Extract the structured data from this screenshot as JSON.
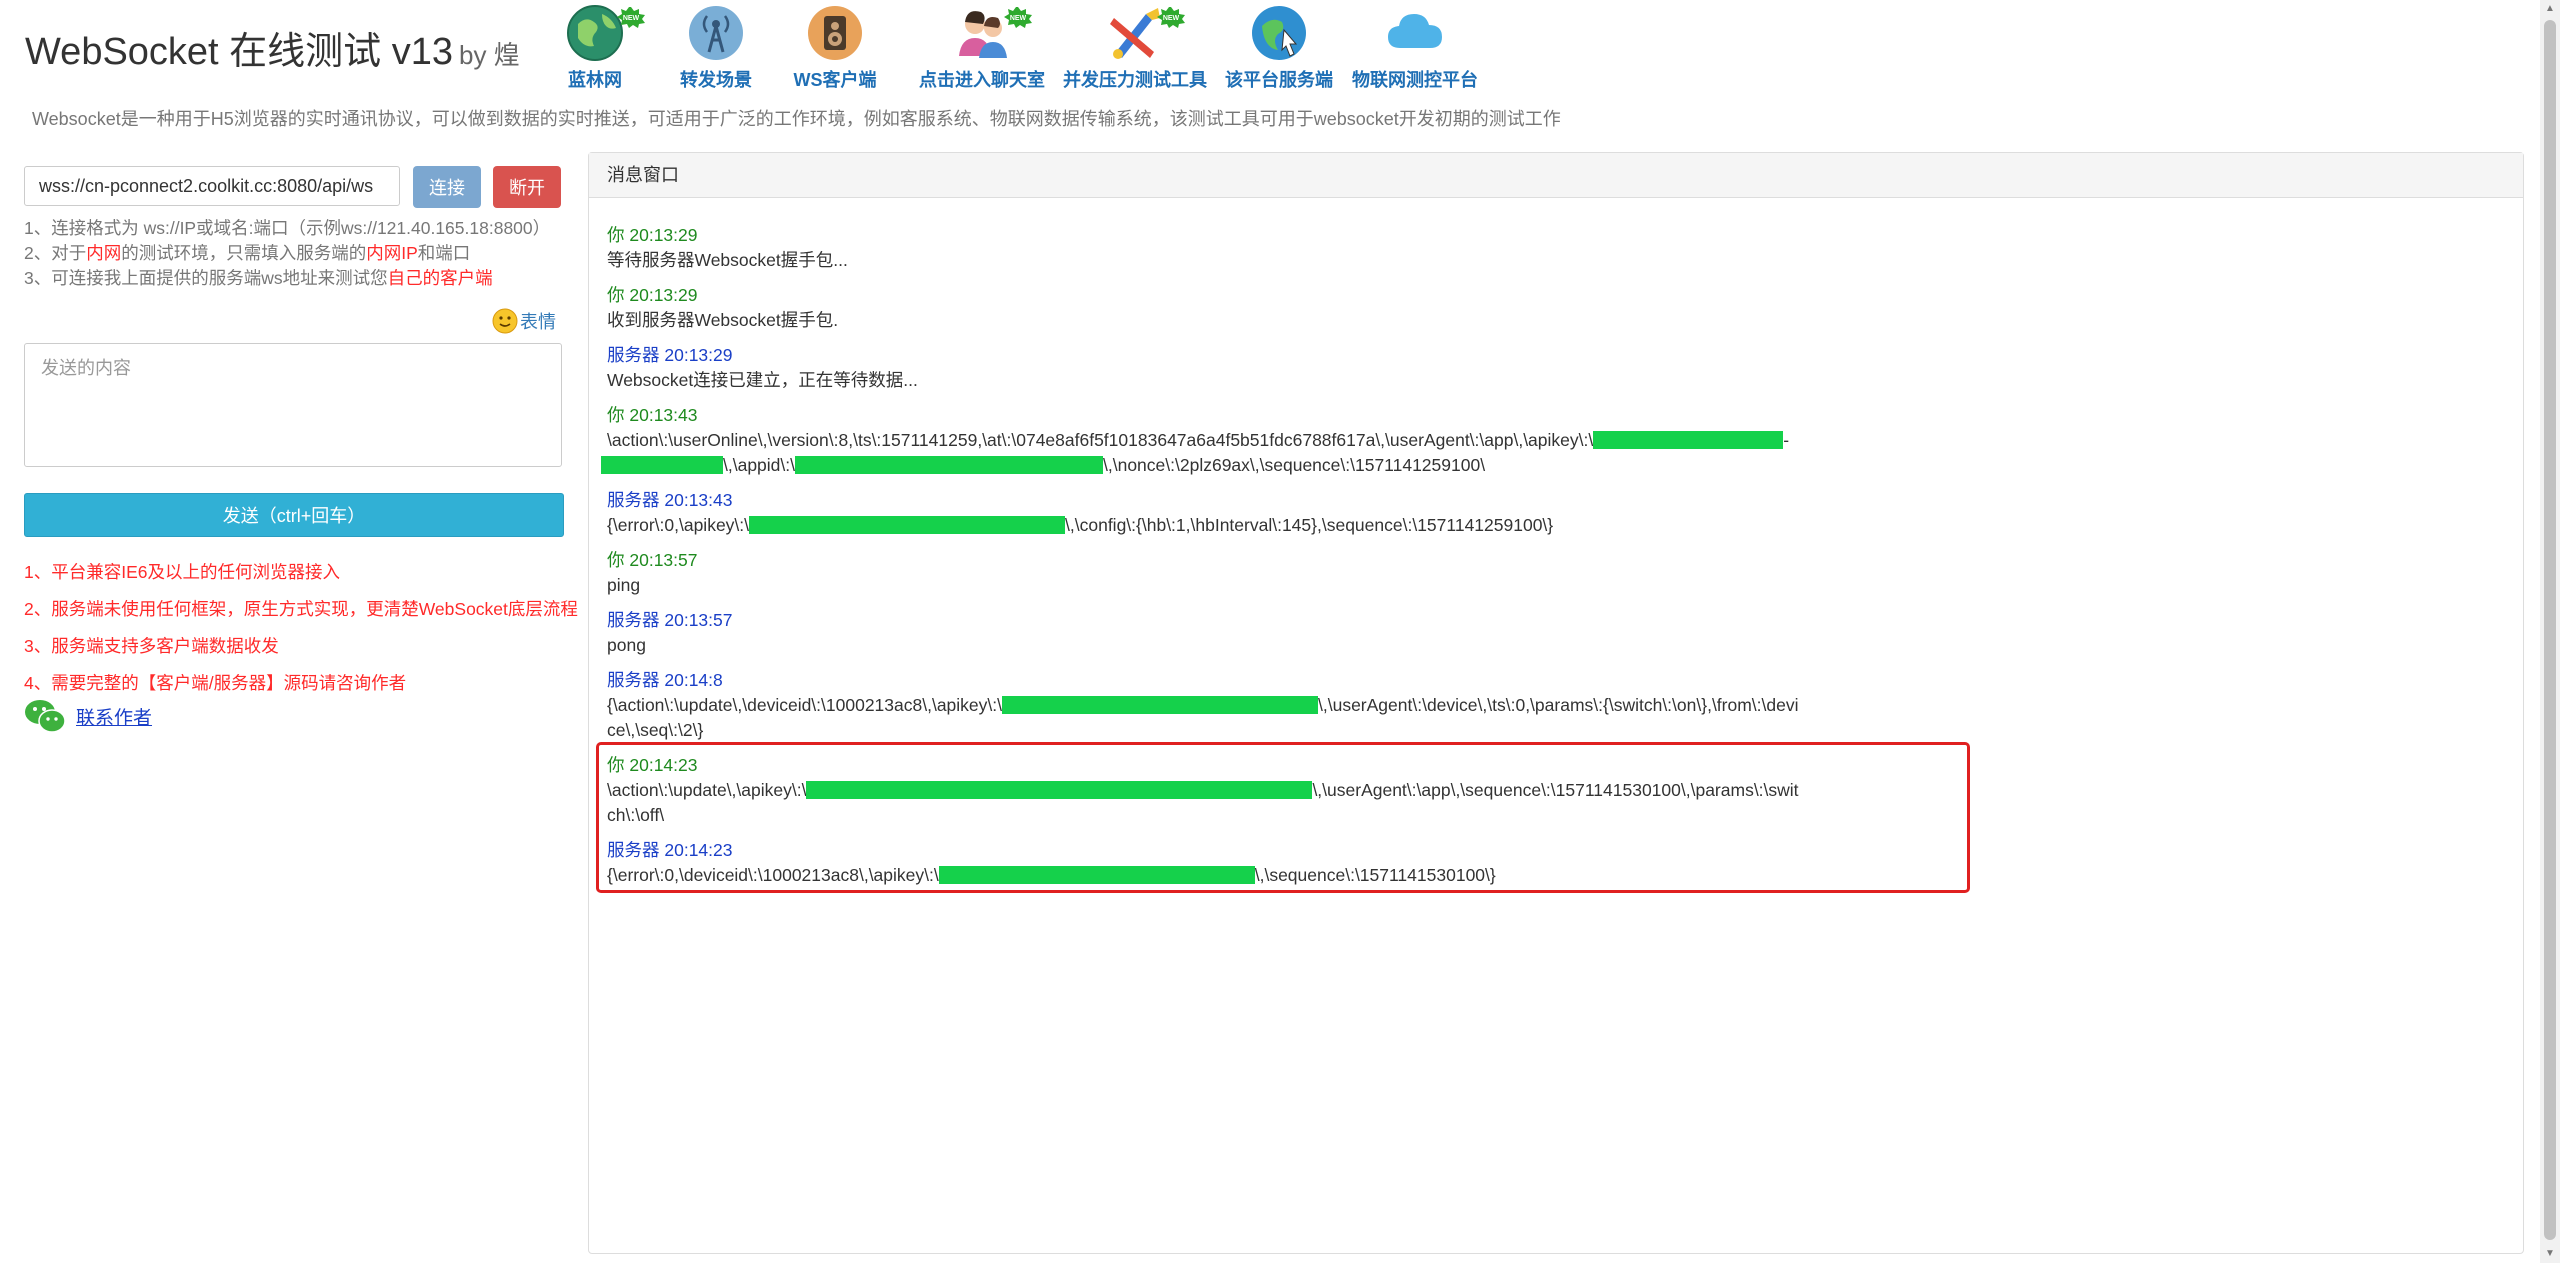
{
  "header": {
    "title": "WebSocket 在线测试 v13",
    "by": "by 煌",
    "intro": "Websocket是一种用于H5浏览器的实时通讯协议，可以做到数据的实时推送，可适用于广泛的工作环境，例如客服系统、物联网数据传输系统，该测试工具可用于websocket开发初期的测试工作"
  },
  "nav": [
    {
      "label": "蓝林网",
      "icon": "earth-icon",
      "new": true
    },
    {
      "label": "转发场景",
      "icon": "antenna-icon",
      "new": false
    },
    {
      "label": "WS客户端",
      "icon": "speaker-icon",
      "new": false
    },
    {
      "label": "点击进入聊天室",
      "icon": "chat-people-icon",
      "new": true
    },
    {
      "label": "并发压力测试工具",
      "icon": "tools-icon",
      "new": true
    },
    {
      "label": "该平台服务端",
      "icon": "globe-cursor-icon",
      "new": false
    },
    {
      "label": "物联网测控平台",
      "icon": "cloud-icon",
      "new": false
    }
  ],
  "new_badge": "NEW",
  "left": {
    "ws_url": "wss://cn-pconnect2.coolkit.cc:8080/api/ws",
    "connect_label": "连接",
    "disconnect_label": "断开",
    "hint1": "1、连接格式为 ws://IP或域名:端口（示例ws://121.40.165.18:8800）",
    "hint2_a": "2、对于",
    "hint2_b": "内网",
    "hint2_c": "的测试环境，只需填入服务端的",
    "hint2_d": "内网IP",
    "hint2_e": "和端口",
    "hint3_a": "3、可连接我上面提供的服务端ws地址来测试您",
    "hint3_b": "自己的客户端",
    "emoji_label": "表情",
    "message_placeholder": "发送的内容",
    "send_label": "发送（ctrl+回车）",
    "features": [
      "1、平台兼容IE6及以上的任何浏览器接入",
      "2、服务端未使用任何框架，原生方式实现，更清楚WebSocket底层流程",
      "3、服务端支持多客户端数据收发",
      "4、需要完整的【客户端/服务器】源码请咨询作者"
    ],
    "contact_label": "联系作者"
  },
  "panel": {
    "title": "消息窗口",
    "messages": [
      {
        "meta": "你 20:13:29",
        "body": "等待服务器Websocket握手包..."
      },
      {
        "meta": "你 20:13:29",
        "body": "收到服务器Websocket握手包."
      },
      {
        "meta": "服务器 20:13:29",
        "body": "Websocket连接已建立，正在等待数据..."
      },
      {
        "meta": "你 20:13:43",
        "body_a": "\\action\\:\\userOnline\\,\\version\\:8,\\ts\\:1571141259,\\at\\:\\074e8af6f5f10183647a6a4f5b51fdc6788f617a\\,\\userAgent\\:\\app\\,\\apikey\\:\\",
        "body_b": "-",
        "body_c": "\\,\\appid\\:\\",
        "body_d": "\\,\\nonce\\:\\2plz69ax\\,\\sequence\\:\\1571141259100\\"
      },
      {
        "meta": "服务器 20:13:43",
        "body_a": "{\\error\\:0,\\apikey\\:\\",
        "body_b": "\\,\\config\\:{\\hb\\:1,\\hbInterval\\:145},\\sequence\\:\\1571141259100\\}"
      },
      {
        "meta": "你 20:13:57",
        "body": "ping"
      },
      {
        "meta": "服务器 20:13:57",
        "body": "pong"
      },
      {
        "meta": "服务器 20:14:8",
        "body_a": "{\\action\\:\\update\\,\\deviceid\\:\\1000213ac8\\,\\apikey\\:\\",
        "body_b": "\\,\\userAgent\\:\\device\\,\\ts\\:0,\\params\\:{\\switch\\:\\on\\},\\from\\:\\device\\,\\seq\\:\\2\\}"
      },
      {
        "meta": "你 20:14:23",
        "body_a": "\\action\\:\\update\\,\\apikey\\:\\",
        "body_b": "\\,\\userAgent\\:\\app\\,\\sequence\\:\\1571141530100\\,\\params\\:\\switch\\:\\off\\"
      },
      {
        "meta": "服务器 20:14:23",
        "body_a": "{\\error\\:0,\\deviceid\\:\\1000213ac8\\,\\apikey\\:\\",
        "body_b": "\\,\\sequence\\:\\1571141530100\\}"
      }
    ]
  },
  "colors": {
    "you": "#1f8a1f",
    "server": "#1a3fc7",
    "redaction": "#15d14b",
    "highlight": "#e02020"
  }
}
